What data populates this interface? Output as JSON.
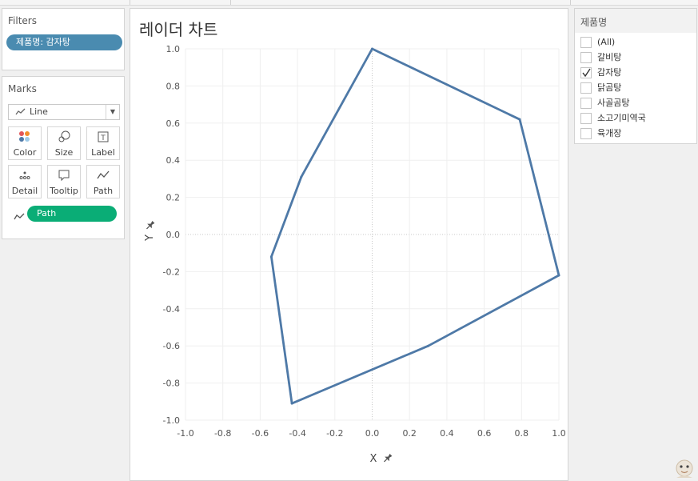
{
  "filters": {
    "title": "Filters",
    "pill_label": "제품명: 감자탕"
  },
  "marks": {
    "title": "Marks",
    "mark_type": "Line",
    "buttons": [
      {
        "label": "Color",
        "icon": "color-dots-icon"
      },
      {
        "label": "Size",
        "icon": "size-circles-icon"
      },
      {
        "label": "Label",
        "icon": "label-t-icon"
      },
      {
        "label": "Detail",
        "icon": "detail-dots-icon"
      },
      {
        "label": "Tooltip",
        "icon": "tooltip-bubble-icon"
      },
      {
        "label": "Path",
        "icon": "path-line-icon"
      }
    ],
    "path_pill_label": "Path",
    "path_pill_icon": "path-line-icon",
    "pill_colors": {
      "filter": "#4a8bb0",
      "path": "#0aad76"
    }
  },
  "chart": {
    "title": "레이더 차트",
    "x_axis_title": "X",
    "y_axis_title": "Y",
    "axis_pin_icon": "pin-icon",
    "line_color": "#4e79a7"
  },
  "chart_data": {
    "type": "line",
    "title": "레이더 차트",
    "xlabel": "X",
    "ylabel": "Y",
    "xlim": [
      -1.0,
      1.0
    ],
    "ylim": [
      -1.0,
      1.0
    ],
    "x_ticks": [
      "-1.0",
      "-0.8",
      "-0.6",
      "-0.4",
      "-0.2",
      "0.0",
      "0.2",
      "0.4",
      "0.6",
      "0.8",
      "1.0"
    ],
    "y_ticks": [
      "1.0",
      "0.8",
      "0.6",
      "0.4",
      "0.2",
      "0.0",
      "-0.2",
      "-0.4",
      "-0.6",
      "-0.8",
      "-1.0"
    ],
    "grid": true,
    "closed_path": true,
    "series": [
      {
        "points": [
          {
            "x": 0.0,
            "y": 1.0
          },
          {
            "x": 0.79,
            "y": 0.62
          },
          {
            "x": 1.0,
            "y": -0.22
          },
          {
            "x": 0.3,
            "y": -0.6
          },
          {
            "x": -0.43,
            "y": -0.91
          },
          {
            "x": -0.54,
            "y": -0.12
          },
          {
            "x": -0.38,
            "y": 0.31
          }
        ]
      }
    ]
  },
  "product_filter": {
    "title": "제품명",
    "options": [
      {
        "label": "(All)",
        "checked": false
      },
      {
        "label": "갈비탕",
        "checked": false
      },
      {
        "label": "감자탕",
        "checked": true
      },
      {
        "label": "닭곰탕",
        "checked": false
      },
      {
        "label": "사골곰탕",
        "checked": false
      },
      {
        "label": "소고기미역국",
        "checked": false
      },
      {
        "label": "육개장",
        "checked": false
      }
    ]
  }
}
